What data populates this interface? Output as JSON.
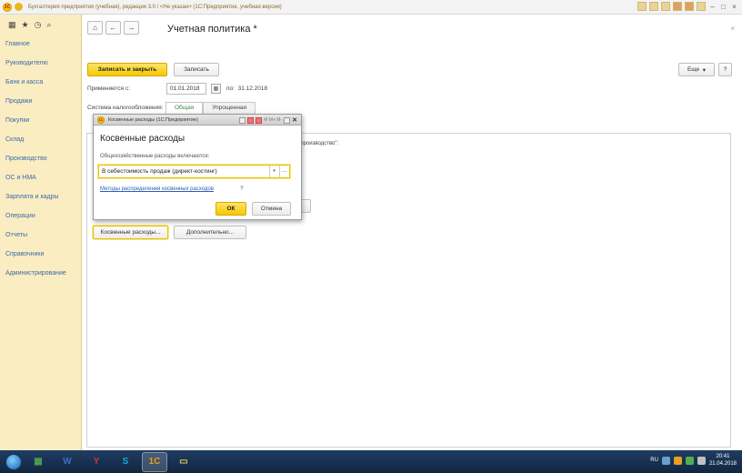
{
  "window": {
    "title": "Бухгалтерия предприятия (учебная), редакция 3.0 / <Не указан> (1С:Предприятие, учебная версия)",
    "logo_text": "1С"
  },
  "sidebar": {
    "items": [
      {
        "label": "Главное"
      },
      {
        "label": "Руководителю"
      },
      {
        "label": "Банк и касса"
      },
      {
        "label": "Продажи"
      },
      {
        "label": "Покупки"
      },
      {
        "label": "Склад"
      },
      {
        "label": "Производство"
      },
      {
        "label": "ОС и НМА"
      },
      {
        "label": "Зарплата и кадры"
      },
      {
        "label": "Операции"
      },
      {
        "label": "Отчеты"
      },
      {
        "label": "Справочники"
      },
      {
        "label": "Администрирование"
      }
    ]
  },
  "form": {
    "title": "Учетная политика *",
    "save_close_label": "Записать и закрыть",
    "save_label": "Записать",
    "more_label": "Еще",
    "help_label": "?",
    "applies_label": "Применяется с:",
    "date_from": "01.01.2018",
    "to_label": "по:",
    "date_to": "31.12.2018",
    "tax_system_label": "Система налогообложения:",
    "tax_tabs": [
      {
        "label": "Общая",
        "active": true
      },
      {
        "label": "Упрощенная",
        "active": false
      }
    ],
    "panel_text": "ое производство\":",
    "indirect_button": "Косвенные расходы...",
    "extra_button": "Дополнительно..."
  },
  "dialog": {
    "title": "Косвенные расходы (1С:Предприятие)",
    "window_buttons": "M M+ M-",
    "heading": "Косвенные расходы",
    "field_label": "Общехозяйственные расходы включаются:",
    "field_value": "В себестоимость продаж (директ-костинг)",
    "link_label": "Методы распределения косвенных расходов",
    "help_label": "?",
    "ok_label": "ОК",
    "cancel_label": "Отмена"
  },
  "taskbar": {
    "apps": [
      {
        "name": "1c-tile-icon",
        "glyph": "▦",
        "color": "#4fa34f"
      },
      {
        "name": "word-icon",
        "glyph": "W",
        "color": "#3a6fc4"
      },
      {
        "name": "yandex-icon",
        "glyph": "Y",
        "color": "#e03030"
      },
      {
        "name": "skype-icon",
        "glyph": "S",
        "color": "#1ba7e0"
      },
      {
        "name": "1c-enterprise-icon",
        "glyph": "1С",
        "color": "#e8a020"
      },
      {
        "name": "explorer-icon",
        "glyph": "▭",
        "color": "#e8c860"
      }
    ],
    "lang": "RU",
    "time": "20:41",
    "date": "21.04.2018"
  }
}
